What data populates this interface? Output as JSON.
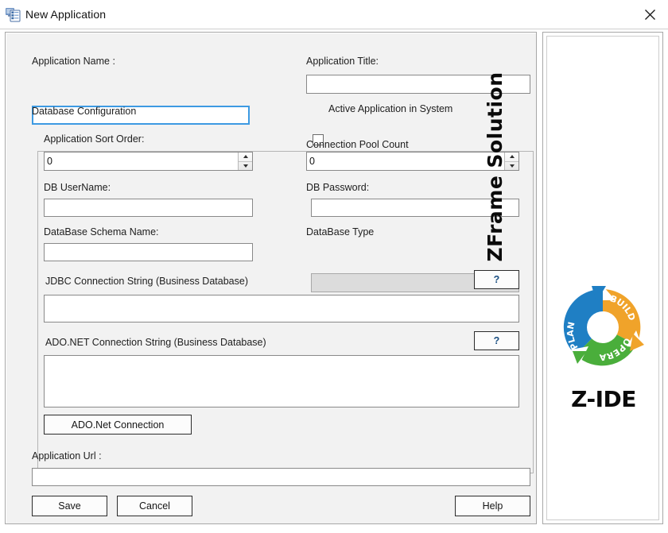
{
  "window": {
    "title": "New Application",
    "icon": "application-form-icon",
    "close_label": "✕"
  },
  "form": {
    "app_name": {
      "label": "Application  Name :",
      "value": "",
      "placeholder": "",
      "focused": true
    },
    "app_title": {
      "label": "Application Title:",
      "value": "",
      "placeholder": ""
    },
    "active_app": {
      "label": "Active Application in System",
      "checked": false
    },
    "db_config_label": "Database Configuration",
    "sort_order": {
      "label": "Application Sort Order:",
      "value": "0"
    },
    "pool_count": {
      "label": "Connection Pool Count",
      "value": "0"
    },
    "db_username": {
      "label": "DB UserName:",
      "value": ""
    },
    "db_password": {
      "label": "DB Password:",
      "value": ""
    },
    "db_schema": {
      "label": "DataBase Schema Name:",
      "value": ""
    },
    "db_type": {
      "label": "DataBase Type",
      "selected": "",
      "enabled": false,
      "options": []
    },
    "jdbc": {
      "label": "JDBC Connection String (Business Database)",
      "value": "",
      "help_label": "?"
    },
    "adonet": {
      "label": "ADO.NET Connection String (Business Database)",
      "value": "",
      "help_label": "?"
    },
    "ado_connection_button": "ADO.Net Connection",
    "app_url": {
      "label": "Application Url :",
      "value": ""
    }
  },
  "buttons": {
    "save": "Save",
    "cancel": "Cancel",
    "help": "Help"
  },
  "branding": {
    "title": "ZFrame Solution",
    "wordmark": "Z-IDE",
    "cycle": {
      "segments": [
        {
          "name": "PLAN",
          "color": "#1f7fc4"
        },
        {
          "name": "BUILD",
          "color": "#f0a32a"
        },
        {
          "name": "OPERATE",
          "color": "#4aae3b"
        }
      ]
    }
  },
  "colors": {
    "focus_border": "#3d9ae2",
    "panel_bg": "#f2f2f2",
    "window_bg": "#ffffff",
    "plan_blue": "#1f7fc4",
    "build_orange": "#f0a32a",
    "operate_green": "#4aae3b"
  }
}
